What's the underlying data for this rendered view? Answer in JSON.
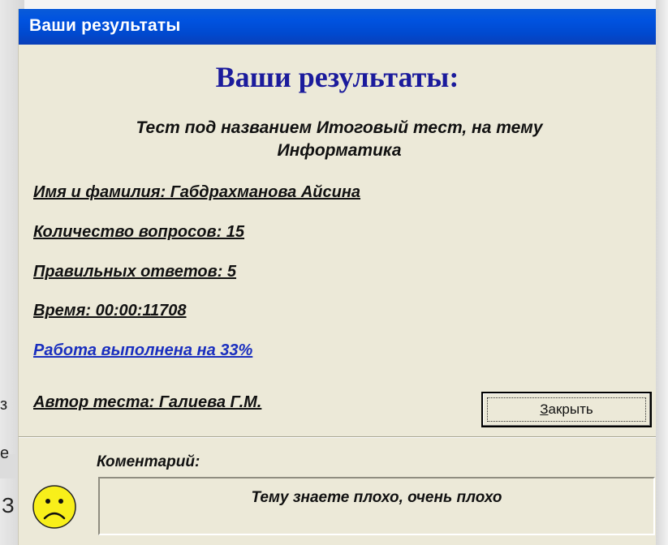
{
  "window": {
    "title": "Ваши результаты"
  },
  "results": {
    "heading": "Ваши результаты:",
    "test_line_1": "Тест под названием Итоговый тест, на тему",
    "test_line_2": "Информатика",
    "name": "Имя и фамилия: Габдрахманова Айсина",
    "questions": "Количество вопросов: 15",
    "correct": "Правильных ответов: 5",
    "time": "Время: 00:00:11708",
    "completion": "Работа выполнена на 33%",
    "author": "Автор теста: Галиева Г.М."
  },
  "buttons": {
    "close_label_mnemonic": "З",
    "close_label_rest": "акрыть"
  },
  "comment": {
    "label": "Коментарий:",
    "text": "Тему знаете плохо, очень плохо",
    "icon": "sad-face-icon"
  },
  "background_fragments": [
    "з",
    "е",
    "З"
  ],
  "colors": {
    "titlebar": "#0053e0",
    "window_bg": "#ece9d8",
    "heading": "#1b1b9c",
    "link": "#1a2fbf",
    "smiley": "#f8ef1a"
  }
}
